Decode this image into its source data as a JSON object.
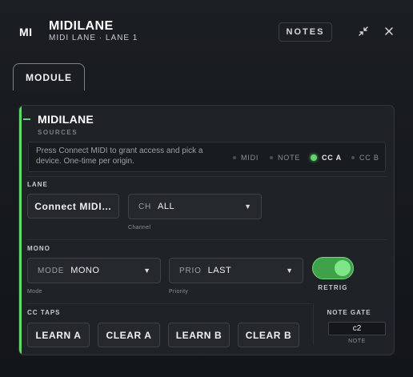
{
  "header": {
    "logo": "MI",
    "title": "MIDILANE",
    "subtitle": "MIDI LANE · LANE 1",
    "notes_label": "NOTES",
    "icons": [
      "collapse-icon",
      "close-icon"
    ]
  },
  "tabs": [
    {
      "label": "MODULE",
      "active": true
    }
  ],
  "card": {
    "title": "MIDILANE",
    "accent_color": "#5fd66a",
    "sources": {
      "label": "SOURCES",
      "hint": "Press Connect MIDI to grant access and pick a device. One-time per origin.",
      "items": [
        {
          "label": "MIDI",
          "active": false
        },
        {
          "label": "NOTE",
          "active": false
        },
        {
          "label": "CC A",
          "active": true
        },
        {
          "label": "CC B",
          "active": false
        }
      ]
    },
    "lane": {
      "label": "LANE",
      "connect_label": "Connect MIDI…",
      "channel": {
        "key": "CH",
        "value": "ALL",
        "caption": "Channel"
      }
    },
    "mono": {
      "label": "MONO",
      "mode": {
        "key": "MODE",
        "value": "MONO",
        "caption": "Mode"
      },
      "prio": {
        "key": "PRIO",
        "value": "LAST",
        "caption": "Priority"
      },
      "retrig": {
        "label": "RETRIG",
        "on": true
      }
    },
    "cc_taps": {
      "label": "CC TAPS",
      "buttons": [
        "LEARN A",
        "CLEAR A",
        "LEARN B",
        "CLEAR B"
      ]
    },
    "note_gate": {
      "label": "NOTE GATE",
      "value": "c2",
      "caption": "NOTE"
    }
  }
}
